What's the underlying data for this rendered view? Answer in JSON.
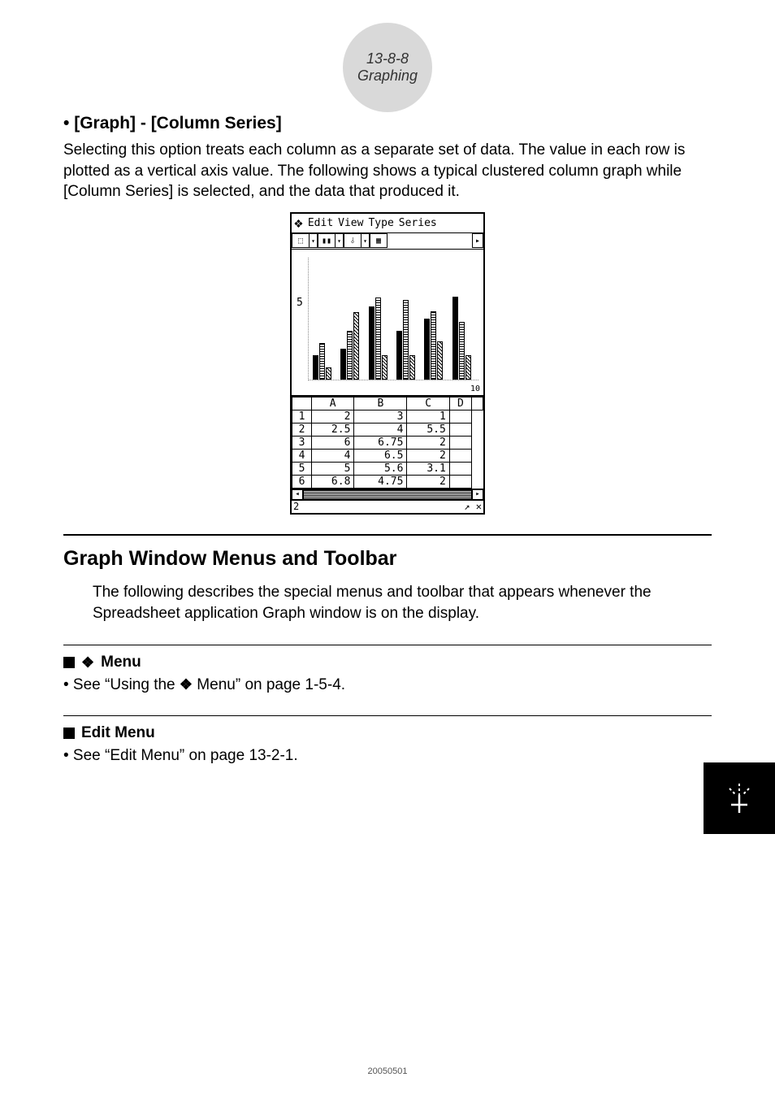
{
  "header": {
    "page_ref": "13-8-8",
    "section": "Graphing"
  },
  "section1": {
    "heading_bullet": "•",
    "heading": "[Graph] - [Column Series]",
    "paragraph": "Selecting this option treats each column as a separate set of data. The value in each row is plotted as a vertical axis value.  The following shows a typical clustered column graph while [Column Series] is selected, and the data that produced it."
  },
  "calc": {
    "menus": [
      "Edit",
      "View",
      "Type",
      "Series"
    ],
    "y_tick": "5",
    "x_tick": "10",
    "sheet_headers": [
      "A",
      "B",
      "C",
      "D"
    ],
    "rows": [
      {
        "n": "1",
        "A": "2",
        "B": "3",
        "C": "1",
        "D": ""
      },
      {
        "n": "2",
        "A": "2.5",
        "B": "4",
        "C": "5.5",
        "D": ""
      },
      {
        "n": "3",
        "A": "6",
        "B": "6.75",
        "C": "2",
        "D": ""
      },
      {
        "n": "4",
        "A": "4",
        "B": "6.5",
        "C": "2",
        "D": ""
      },
      {
        "n": "5",
        "A": "5",
        "B": "5.6",
        "C": "3.1",
        "D": ""
      },
      {
        "n": "6",
        "A": "6.8",
        "B": "4.75",
        "C": "2",
        "D": ""
      }
    ],
    "status_cell": "2"
  },
  "chart_data": {
    "type": "bar",
    "categories": [
      "1",
      "2",
      "3",
      "4",
      "5",
      "6"
    ],
    "series": [
      {
        "name": "A",
        "values": [
          2,
          2.5,
          6,
          4,
          5,
          6.8
        ]
      },
      {
        "name": "B",
        "values": [
          3,
          4,
          6.75,
          6.5,
          5.6,
          4.75
        ]
      },
      {
        "name": "C",
        "values": [
          1,
          5.5,
          2,
          2,
          3.1,
          2
        ]
      }
    ],
    "ylabel": "",
    "xlabel": "",
    "ylim": [
      0,
      10
    ],
    "y_ticks": [
      5
    ],
    "x_ticks": [
      10
    ]
  },
  "section2": {
    "heading": "Graph Window Menus and Toolbar",
    "paragraph": "The following describes the special menus and toolbar that appears whenever the Spreadsheet application Graph window is on the display."
  },
  "menu_block": {
    "label_suffix": "Menu",
    "bullet": "• See “Using the ",
    "bullet_suffix": " Menu” on page 1-5-4."
  },
  "edit_block": {
    "heading": "Edit Menu",
    "bullet": "• See “Edit Menu” on page 13-2-1."
  },
  "footer": {
    "stamp": "20050501"
  }
}
